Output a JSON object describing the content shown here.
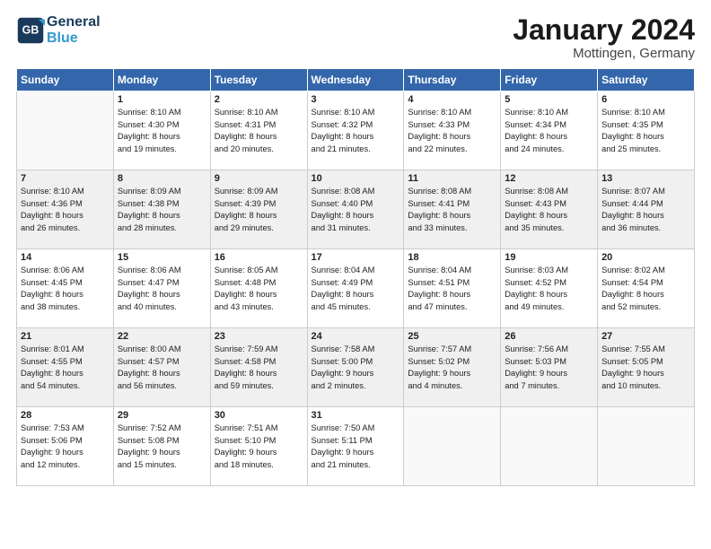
{
  "header": {
    "logo_line1": "General",
    "logo_line2": "Blue",
    "title": "January 2024",
    "subtitle": "Mottingen, Germany"
  },
  "weekdays": [
    "Sunday",
    "Monday",
    "Tuesday",
    "Wednesday",
    "Thursday",
    "Friday",
    "Saturday"
  ],
  "weeks": [
    [
      {
        "day": "",
        "info": ""
      },
      {
        "day": "1",
        "info": "Sunrise: 8:10 AM\nSunset: 4:30 PM\nDaylight: 8 hours\nand 19 minutes."
      },
      {
        "day": "2",
        "info": "Sunrise: 8:10 AM\nSunset: 4:31 PM\nDaylight: 8 hours\nand 20 minutes."
      },
      {
        "day": "3",
        "info": "Sunrise: 8:10 AM\nSunset: 4:32 PM\nDaylight: 8 hours\nand 21 minutes."
      },
      {
        "day": "4",
        "info": "Sunrise: 8:10 AM\nSunset: 4:33 PM\nDaylight: 8 hours\nand 22 minutes."
      },
      {
        "day": "5",
        "info": "Sunrise: 8:10 AM\nSunset: 4:34 PM\nDaylight: 8 hours\nand 24 minutes."
      },
      {
        "day": "6",
        "info": "Sunrise: 8:10 AM\nSunset: 4:35 PM\nDaylight: 8 hours\nand 25 minutes."
      }
    ],
    [
      {
        "day": "7",
        "info": "Sunrise: 8:10 AM\nSunset: 4:36 PM\nDaylight: 8 hours\nand 26 minutes."
      },
      {
        "day": "8",
        "info": "Sunrise: 8:09 AM\nSunset: 4:38 PM\nDaylight: 8 hours\nand 28 minutes."
      },
      {
        "day": "9",
        "info": "Sunrise: 8:09 AM\nSunset: 4:39 PM\nDaylight: 8 hours\nand 29 minutes."
      },
      {
        "day": "10",
        "info": "Sunrise: 8:08 AM\nSunset: 4:40 PM\nDaylight: 8 hours\nand 31 minutes."
      },
      {
        "day": "11",
        "info": "Sunrise: 8:08 AM\nSunset: 4:41 PM\nDaylight: 8 hours\nand 33 minutes."
      },
      {
        "day": "12",
        "info": "Sunrise: 8:08 AM\nSunset: 4:43 PM\nDaylight: 8 hours\nand 35 minutes."
      },
      {
        "day": "13",
        "info": "Sunrise: 8:07 AM\nSunset: 4:44 PM\nDaylight: 8 hours\nand 36 minutes."
      }
    ],
    [
      {
        "day": "14",
        "info": "Sunrise: 8:06 AM\nSunset: 4:45 PM\nDaylight: 8 hours\nand 38 minutes."
      },
      {
        "day": "15",
        "info": "Sunrise: 8:06 AM\nSunset: 4:47 PM\nDaylight: 8 hours\nand 40 minutes."
      },
      {
        "day": "16",
        "info": "Sunrise: 8:05 AM\nSunset: 4:48 PM\nDaylight: 8 hours\nand 43 minutes."
      },
      {
        "day": "17",
        "info": "Sunrise: 8:04 AM\nSunset: 4:49 PM\nDaylight: 8 hours\nand 45 minutes."
      },
      {
        "day": "18",
        "info": "Sunrise: 8:04 AM\nSunset: 4:51 PM\nDaylight: 8 hours\nand 47 minutes."
      },
      {
        "day": "19",
        "info": "Sunrise: 8:03 AM\nSunset: 4:52 PM\nDaylight: 8 hours\nand 49 minutes."
      },
      {
        "day": "20",
        "info": "Sunrise: 8:02 AM\nSunset: 4:54 PM\nDaylight: 8 hours\nand 52 minutes."
      }
    ],
    [
      {
        "day": "21",
        "info": "Sunrise: 8:01 AM\nSunset: 4:55 PM\nDaylight: 8 hours\nand 54 minutes."
      },
      {
        "day": "22",
        "info": "Sunrise: 8:00 AM\nSunset: 4:57 PM\nDaylight: 8 hours\nand 56 minutes."
      },
      {
        "day": "23",
        "info": "Sunrise: 7:59 AM\nSunset: 4:58 PM\nDaylight: 8 hours\nand 59 minutes."
      },
      {
        "day": "24",
        "info": "Sunrise: 7:58 AM\nSunset: 5:00 PM\nDaylight: 9 hours\nand 2 minutes."
      },
      {
        "day": "25",
        "info": "Sunrise: 7:57 AM\nSunset: 5:02 PM\nDaylight: 9 hours\nand 4 minutes."
      },
      {
        "day": "26",
        "info": "Sunrise: 7:56 AM\nSunset: 5:03 PM\nDaylight: 9 hours\nand 7 minutes."
      },
      {
        "day": "27",
        "info": "Sunrise: 7:55 AM\nSunset: 5:05 PM\nDaylight: 9 hours\nand 10 minutes."
      }
    ],
    [
      {
        "day": "28",
        "info": "Sunrise: 7:53 AM\nSunset: 5:06 PM\nDaylight: 9 hours\nand 12 minutes."
      },
      {
        "day": "29",
        "info": "Sunrise: 7:52 AM\nSunset: 5:08 PM\nDaylight: 9 hours\nand 15 minutes."
      },
      {
        "day": "30",
        "info": "Sunrise: 7:51 AM\nSunset: 5:10 PM\nDaylight: 9 hours\nand 18 minutes."
      },
      {
        "day": "31",
        "info": "Sunrise: 7:50 AM\nSunset: 5:11 PM\nDaylight: 9 hours\nand 21 minutes."
      },
      {
        "day": "",
        "info": ""
      },
      {
        "day": "",
        "info": ""
      },
      {
        "day": "",
        "info": ""
      }
    ]
  ]
}
